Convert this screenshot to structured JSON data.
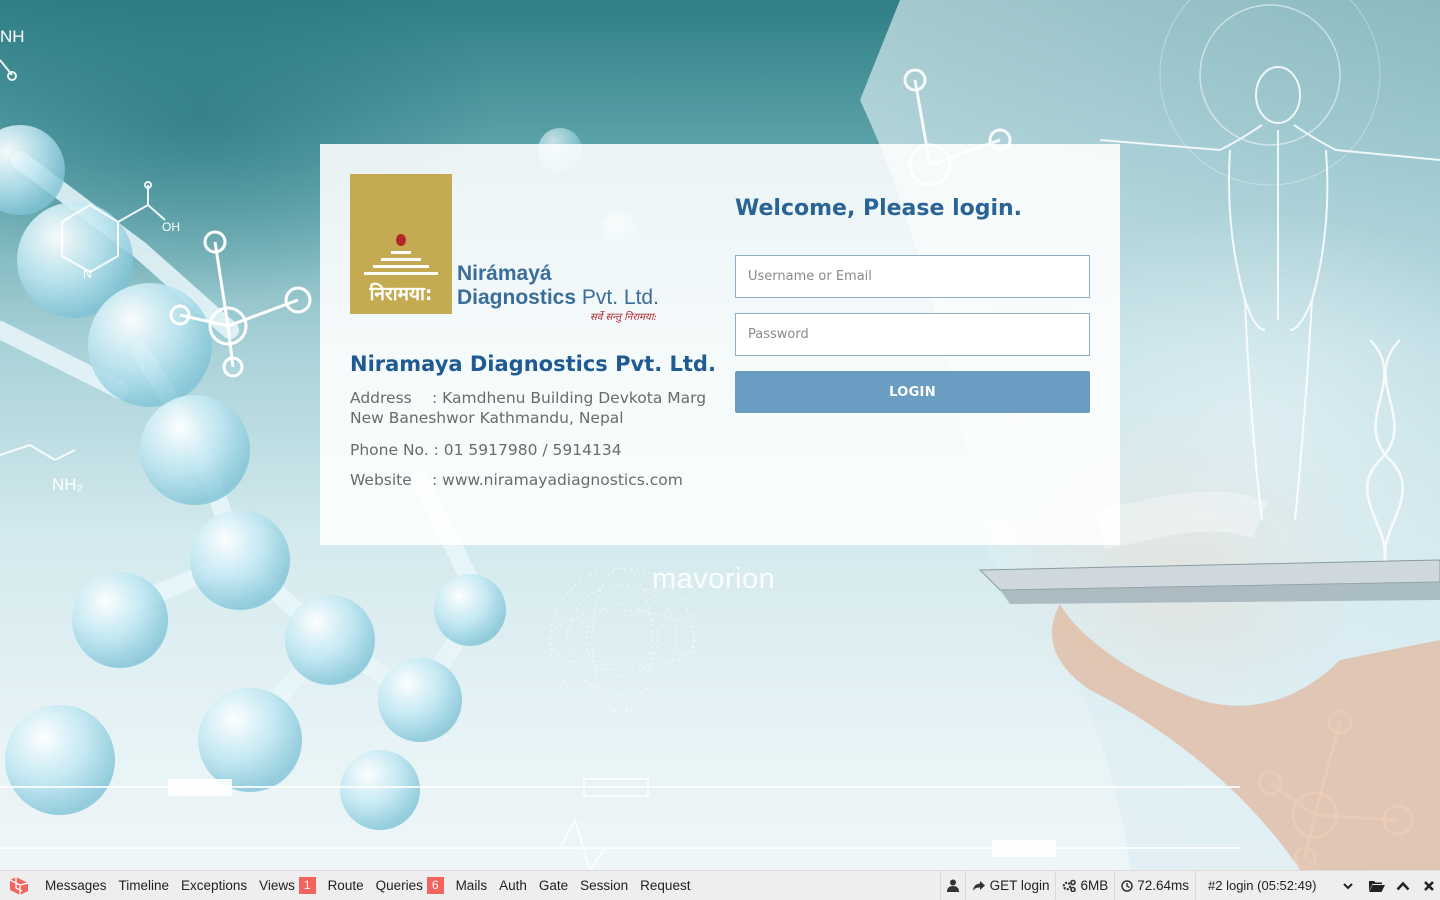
{
  "background": {
    "watermark": "mavorion",
    "molecule_labels": [
      "NH",
      "OH",
      "N",
      "NH₂"
    ]
  },
  "company": {
    "logo_name": "Nirámayá",
    "logo_name_line2": "Diagnostics",
    "logo_suffix": "Pvt. Ltd.",
    "logo_hindi": "निरामया:",
    "logo_tagline": "सर्वे सन्तु निरामया:",
    "name": "Niramaya Diagnostics Pvt. Ltd.",
    "address_label": "Address",
    "address_line1": ": Kamdhenu Building Devkota Marg",
    "address_line2": "New Baneshwor Kathmandu, Nepal",
    "phone_label": "Phone No.",
    "phone_value": ": 01 5917980 / 5914134",
    "website_label": "Website",
    "website_value": ": www.niramayadiagnostics.com"
  },
  "login": {
    "heading": "Welcome, Please login.",
    "username_placeholder": "Username or Email",
    "password_placeholder": "Password",
    "button": "LOGIN"
  },
  "debugbar": {
    "tabs": [
      {
        "label": "Messages"
      },
      {
        "label": "Timeline"
      },
      {
        "label": "Exceptions"
      },
      {
        "label": "Views",
        "badge": "1"
      },
      {
        "label": "Route"
      },
      {
        "label": "Queries",
        "badge": "6"
      },
      {
        "label": "Mails"
      },
      {
        "label": "Auth"
      },
      {
        "label": "Gate"
      },
      {
        "label": "Session"
      },
      {
        "label": "Request"
      }
    ],
    "request": "GET login",
    "memory": "6MB",
    "time": "72.64ms",
    "selected_request": "#2 login (05:52:49)",
    "badge_color": "#f4645f",
    "icons": [
      "laravel-logo-icon",
      "user-icon",
      "share-icon",
      "cogs-icon",
      "clock-icon",
      "folder-open-icon",
      "chevron-up-icon",
      "close-icon"
    ]
  }
}
